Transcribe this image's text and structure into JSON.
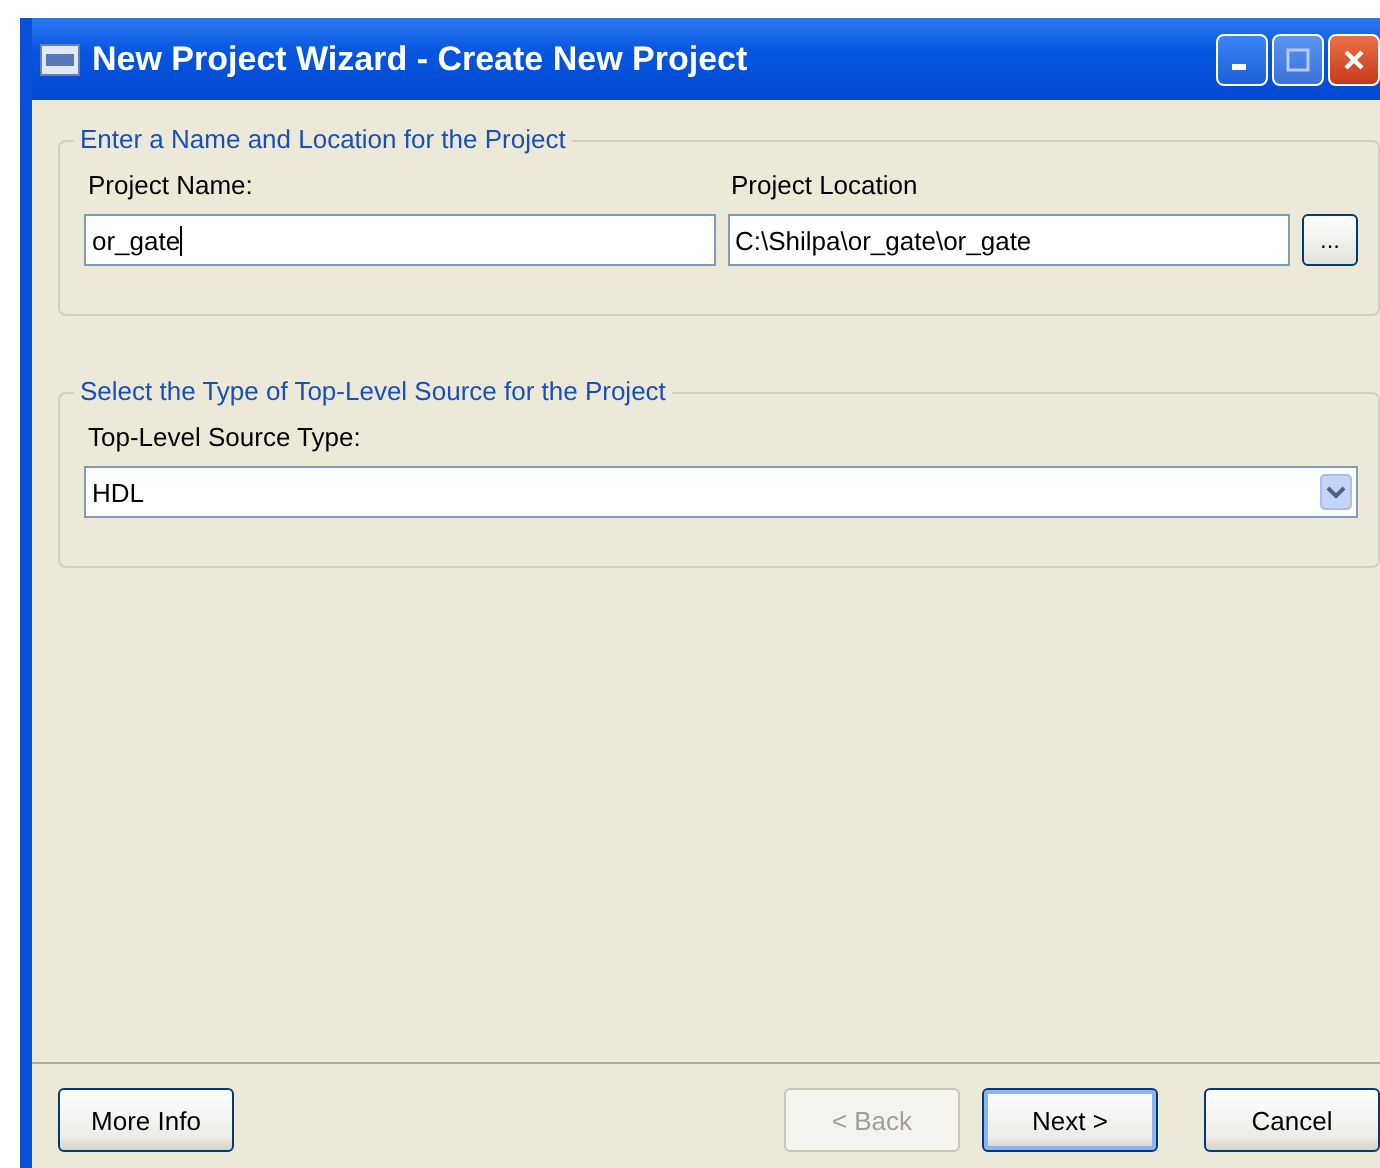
{
  "window": {
    "title": "New Project Wizard - Create New Project"
  },
  "groups": [
    {
      "legend": "Enter a Name and Location for the Project",
      "fields": [
        {
          "kind": "text",
          "label": "Project Name:",
          "value": "or_gate",
          "focused": true
        },
        {
          "kind": "text",
          "label": "Project Location",
          "value": "C:\\Shilpa\\or_gate\\or_gate",
          "browse": "..."
        }
      ]
    },
    {
      "legend": "Select the Type of Top-Level Source for the Project",
      "fields": [
        {
          "kind": "dropdown",
          "label": "Top-Level Source Type:",
          "value": "HDL"
        }
      ]
    }
  ],
  "buttons": [
    {
      "label": "More Info",
      "disabled": false,
      "default": false
    },
    {
      "label": "< Back",
      "disabled": true,
      "default": false
    },
    {
      "label": "Next >",
      "disabled": false,
      "default": true
    },
    {
      "label": "Cancel",
      "disabled": false,
      "default": false
    }
  ]
}
